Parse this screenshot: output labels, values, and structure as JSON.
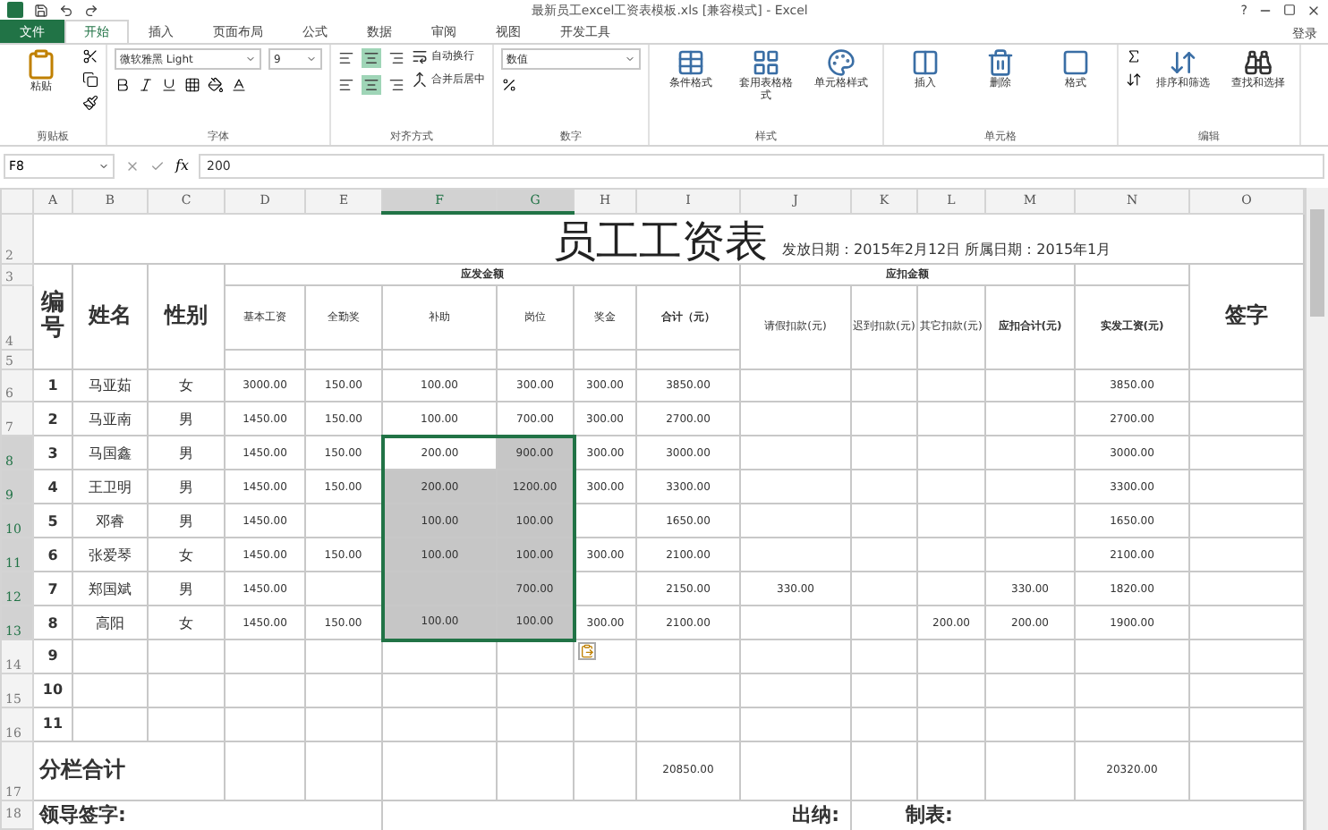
{
  "window": {
    "title": "最新员工excel工资表模板.xls [兼容模式] - Excel",
    "help": "?",
    "account": "登录"
  },
  "ribbon": {
    "tabs": [
      {
        "label": "文件",
        "kind": "file",
        "selected": false
      },
      {
        "label": "开始",
        "kind": "tab",
        "selected": true
      },
      {
        "label": "插入",
        "kind": "tab",
        "selected": false
      },
      {
        "label": "页面布局",
        "kind": "tab",
        "selected": false
      },
      {
        "label": "公式",
        "kind": "tab",
        "selected": false
      },
      {
        "label": "数据",
        "kind": "tab",
        "selected": false
      },
      {
        "label": "审阅",
        "kind": "tab",
        "selected": false
      },
      {
        "label": "视图",
        "kind": "tab",
        "selected": false
      },
      {
        "label": "开发工具",
        "kind": "tab",
        "selected": false
      }
    ],
    "groups": [
      {
        "kind": "clipboard",
        "label": "剪贴板",
        "buttons": [
          "粘贴"
        ]
      },
      {
        "kind": "font",
        "label": "字体",
        "font": "微软雅黑 Light",
        "size": "9"
      },
      {
        "kind": "align",
        "label": "对齐方式",
        "buttons": [
          "自动换行",
          "合并后居中"
        ]
      },
      {
        "kind": "number",
        "label": "数字",
        "format": "数值"
      },
      {
        "kind": "large",
        "label": "样式",
        "buttons": [
          "条件格式",
          "套用表格格式",
          "单元格样式"
        ]
      },
      {
        "kind": "large",
        "label": "单元格",
        "buttons": [
          "插入",
          "删除",
          "格式"
        ]
      },
      {
        "kind": "edit",
        "label": "编辑",
        "buttons": [
          "排序和筛选",
          "查找和选择"
        ]
      }
    ]
  },
  "formula_bar": {
    "name_box": "F8",
    "fx": "fx",
    "value": "200"
  },
  "sheet": {
    "columns": [
      {
        "label": "A",
        "selected": false
      },
      {
        "label": "B",
        "selected": false
      },
      {
        "label": "C",
        "selected": false
      },
      {
        "label": "D",
        "selected": false
      },
      {
        "label": "E",
        "selected": false
      },
      {
        "label": "F",
        "selected": true
      },
      {
        "label": "G",
        "selected": true
      },
      {
        "label": "H",
        "selected": false
      },
      {
        "label": "I",
        "selected": false
      },
      {
        "label": "J",
        "selected": false
      },
      {
        "label": "K",
        "selected": false
      },
      {
        "label": "L",
        "selected": false
      },
      {
        "label": "M",
        "selected": false
      },
      {
        "label": "N",
        "selected": false
      },
      {
        "label": "O",
        "selected": false
      }
    ],
    "title_row": "2",
    "title": "员工工资表",
    "dates": "发放日期：2015年2月12日 所属日期：2015年1月",
    "header_rows": [
      "3",
      "4",
      "5"
    ],
    "headers": {
      "no": "编号",
      "name": "姓名",
      "gender": "性别",
      "pay_group": "应发金额",
      "pay": [
        "基本工资",
        "全勤奖",
        "补助",
        "岗位",
        "奖金",
        "合计（元）"
      ],
      "deduct_group": "应扣金额",
      "deduct": [
        "请假扣款(元)",
        "迟到扣款(元)",
        "其它扣款(元)",
        "应扣合计(元)"
      ],
      "net": "实发工资(元)",
      "sign": "签字"
    },
    "rows": [
      {
        "header": "6",
        "selected": false,
        "active": false,
        "cells": [
          "1",
          "马亚茹",
          "女",
          "3000.00",
          "150.00",
          "100.00",
          "300.00",
          "300.00",
          "3850.00",
          null,
          null,
          null,
          null,
          "3850.00",
          null
        ]
      },
      {
        "header": "7",
        "selected": false,
        "active": false,
        "cells": [
          "2",
          "马亚南",
          "男",
          "1450.00",
          "150.00",
          "100.00",
          "700.00",
          "300.00",
          "2700.00",
          null,
          null,
          null,
          null,
          "2700.00",
          null
        ]
      },
      {
        "header": "8",
        "selected": true,
        "active": true,
        "cells": [
          "3",
          "马国鑫",
          "男",
          "1450.00",
          "150.00",
          "200.00",
          "900.00",
          "300.00",
          "3000.00",
          null,
          null,
          null,
          null,
          "3000.00",
          null
        ]
      },
      {
        "header": "9",
        "selected": true,
        "active": false,
        "cells": [
          "4",
          "王卫明",
          "男",
          "1450.00",
          "150.00",
          "200.00",
          "1200.00",
          "300.00",
          "3300.00",
          null,
          null,
          null,
          null,
          "3300.00",
          null
        ]
      },
      {
        "header": "10",
        "selected": true,
        "active": false,
        "cells": [
          "5",
          "邓睿",
          "男",
          "1450.00",
          null,
          "100.00",
          "100.00",
          null,
          "1650.00",
          null,
          null,
          null,
          null,
          "1650.00",
          null
        ]
      },
      {
        "header": "11",
        "selected": true,
        "active": false,
        "cells": [
          "6",
          "张爱琴",
          "女",
          "1450.00",
          "150.00",
          "100.00",
          "100.00",
          "300.00",
          "2100.00",
          null,
          null,
          null,
          null,
          "2100.00",
          null
        ]
      },
      {
        "header": "12",
        "selected": true,
        "active": false,
        "cells": [
          "7",
          "郑国斌",
          "男",
          "1450.00",
          null,
          null,
          "700.00",
          null,
          "2150.00",
          "330.00",
          null,
          null,
          "330.00",
          "1820.00",
          null
        ]
      },
      {
        "header": "13",
        "selected": true,
        "active": false,
        "cells": [
          "8",
          "高阳",
          "女",
          "1450.00",
          "150.00",
          "100.00",
          "100.00",
          "300.00",
          "2100.00",
          null,
          null,
          "200.00",
          "200.00",
          "1900.00",
          null
        ]
      },
      {
        "header": "14",
        "selected": false,
        "active": false,
        "cells": [
          "9",
          null,
          null,
          null,
          null,
          null,
          null,
          null,
          null,
          null,
          null,
          null,
          null,
          null,
          null
        ]
      },
      {
        "header": "15",
        "selected": false,
        "active": false,
        "cells": [
          "10",
          null,
          null,
          null,
          null,
          null,
          null,
          null,
          null,
          null,
          null,
          null,
          null,
          null,
          null
        ]
      },
      {
        "header": "16",
        "selected": false,
        "active": false,
        "cells": [
          "11",
          null,
          null,
          null,
          null,
          null,
          null,
          null,
          null,
          null,
          null,
          null,
          null,
          null,
          null
        ]
      }
    ],
    "total": {
      "header": "17",
      "label": "分栏合计",
      "sum": "20850.00",
      "net": "20320.00"
    },
    "footer": {
      "header": "18",
      "leader": "领导签字:",
      "cashier": "出纳:",
      "maker": "制表:"
    }
  }
}
